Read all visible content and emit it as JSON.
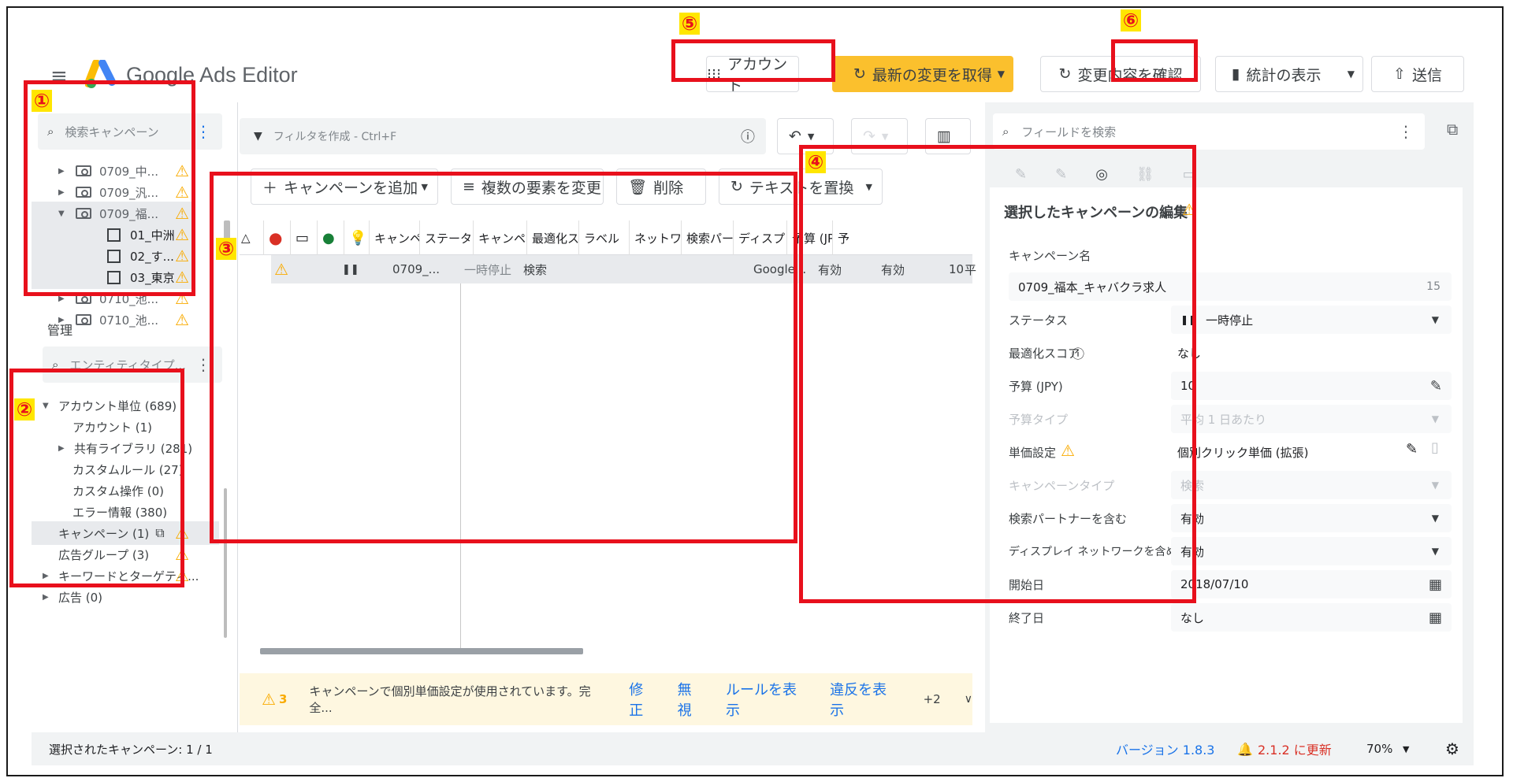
{
  "app": {
    "title": "Google Ads Editor"
  },
  "toolbar": {
    "account": "アカウント",
    "get_changes": "最新の変更を取得",
    "review_changes": "変更内容を確認",
    "view_stats": "統計の表示",
    "send": "送信"
  },
  "badges": [
    "①",
    "②",
    "③",
    "④",
    "⑤",
    "⑥"
  ],
  "tree": {
    "search_placeholder": "検索キャンペーン",
    "campaigns": [
      {
        "label": "0709_中..."
      },
      {
        "label": "0709_汎..."
      },
      {
        "label": "0709_福..."
      }
    ],
    "adgroups": [
      {
        "label": "01_中洲"
      },
      {
        "label": "02_す..."
      },
      {
        "label": "03_東京"
      }
    ],
    "campaigns_after": [
      {
        "label": "0710_池..."
      },
      {
        "label": "0710_池..."
      }
    ]
  },
  "manage": {
    "title": "管理",
    "search_placeholder": "エンティティタイプ...",
    "items": [
      {
        "label": "アカウント単位 (689)"
      },
      {
        "label": "アカウント (1)"
      },
      {
        "label": "共有ライブラリ (281)"
      },
      {
        "label": "カスタムルール (27)"
      },
      {
        "label": "カスタム操作 (0)"
      },
      {
        "label": "エラー情報 (380)"
      },
      {
        "label": "キャンペーン (1)"
      },
      {
        "label": "広告グループ (3)"
      },
      {
        "label": "キーワードとターゲティ..."
      },
      {
        "label": "広告 (0)"
      }
    ]
  },
  "middle": {
    "filter_placeholder": "フィルタを作成 - Ctrl+F",
    "add_campaign": "キャンペーンを追加",
    "multi_edit": "複数の要素を変更",
    "delete": "削除",
    "replace_text": "テキストを置換",
    "columns": [
      "キャンペー...",
      "ステータス",
      "キャンペー...",
      "最適化ス...",
      "ラベル",
      "ネットワーク",
      "検索パー...",
      "ディスプレ...",
      "予算 (JP...",
      "予"
    ],
    "row": {
      "name": "0709_...",
      "status": "一時停止",
      "type": "検索",
      "network": "Google...",
      "search_partner": "有効",
      "display": "有効",
      "budget": "10",
      "extra": "平"
    },
    "notice": {
      "count": "3",
      "text": "キャンペーンで個別単価設定が使用されています。完全...",
      "fix": "修正",
      "ignore": "無視",
      "show_rule": "ルールを表示",
      "show_violation": "違反を表示",
      "more": "+2"
    }
  },
  "edit": {
    "search_placeholder": "フィールドを検索",
    "title": "選択したキャンペーンの編集",
    "fields": {
      "name_label": "キャンペーン名",
      "name_value": "0709_福本_キャバクラ求人",
      "name_count": "15",
      "status_label": "ステータス",
      "status_value": "一時停止",
      "score_label": "最適化スコア",
      "score_value": "なし",
      "budget_label": "予算 (JPY)",
      "budget_value": "10",
      "budget_type_label": "予算タイプ",
      "budget_type_value": "平均 1 日あたり",
      "bid_label": "単価設定",
      "bid_value": "個別クリック単価 (拡張)",
      "camp_type_label": "キャンペーンタイプ",
      "camp_type_value": "検索",
      "search_partner_label": "検索パートナーを含む",
      "search_partner_value": "有効",
      "display_label": "ディスプレイ ネットワークを含める",
      "display_value": "有効",
      "start_label": "開始日",
      "start_value": "2018/07/10",
      "end_label": "終了日",
      "end_value": "なし"
    }
  },
  "status": {
    "selected": "選択されたキャンペーン: 1 / 1",
    "version": "バージョン 1.8.3",
    "update": "2.1.2 に更新",
    "zoom": "70%"
  },
  "colors": {
    "highlight": "#e8101c",
    "badge": "#ffe600",
    "primary_button": "#fbc02d",
    "link": "#1a73e8",
    "warning": "#f9ab00"
  }
}
